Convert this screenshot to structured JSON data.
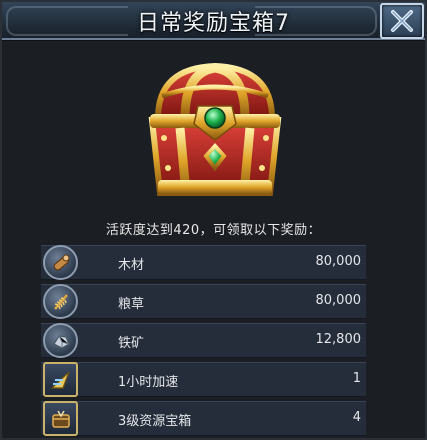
{
  "title": "日常奖励宝箱7",
  "description": "活跃度达到420，可领取以下奖励：",
  "rewards": [
    {
      "icon": "wood-icon",
      "name": "木材",
      "amount": "80,000"
    },
    {
      "icon": "grain-icon",
      "name": "粮草",
      "amount": "80,000"
    },
    {
      "icon": "iron-ore-icon",
      "name": "铁矿",
      "amount": "12,800"
    },
    {
      "icon": "speedup-icon",
      "name": "1小时加速",
      "amount": "1"
    },
    {
      "icon": "resource-chest-icon",
      "name": "3级资源宝箱",
      "amount": "4"
    }
  ]
}
